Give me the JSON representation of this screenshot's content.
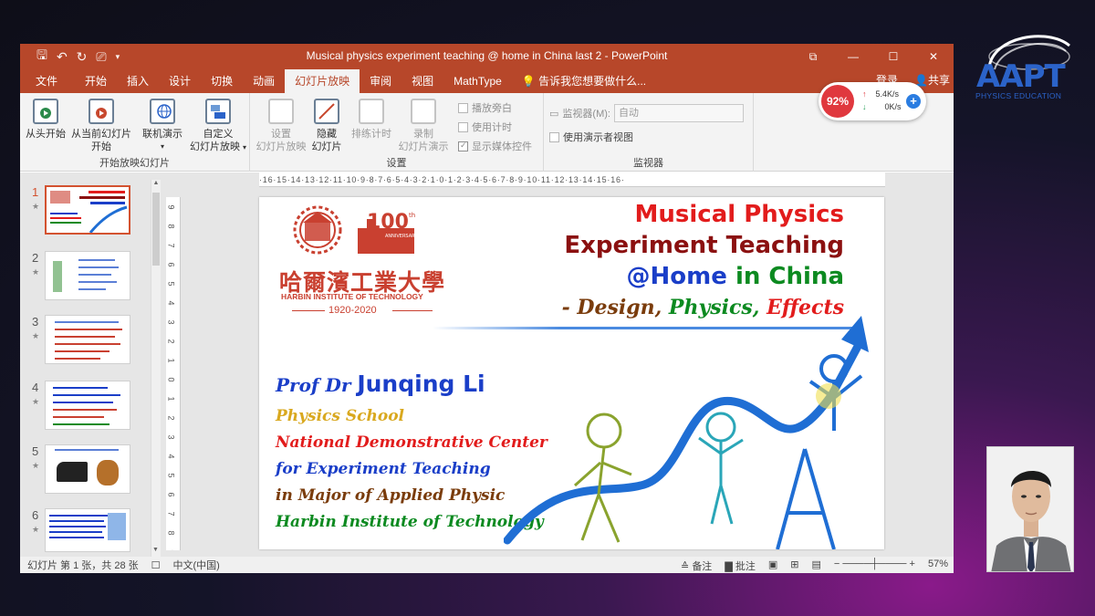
{
  "window": {
    "title": "Musical physics experiment teaching @ home in China last 2  -  PowerPoint"
  },
  "tabs": [
    {
      "label": "文件",
      "active": false
    },
    {
      "label": "开始",
      "active": false
    },
    {
      "label": "插入",
      "active": false
    },
    {
      "label": "设计",
      "active": false
    },
    {
      "label": "切换",
      "active": false
    },
    {
      "label": "动画",
      "active": false
    },
    {
      "label": "幻灯片放映",
      "active": true
    },
    {
      "label": "审阅",
      "active": false
    },
    {
      "label": "视图",
      "active": false
    },
    {
      "label": "MathType",
      "active": false
    }
  ],
  "tell_me": "告诉我您想要做什么...",
  "signin": "登录",
  "share": "共享",
  "ribbon": {
    "start_group": {
      "label": "开始放映幻灯片",
      "from_beginning": "从头开始",
      "from_current_1": "从当前幻灯片",
      "from_current_2": "开始",
      "online_present": "联机演示",
      "custom_1": "自定义",
      "custom_2": "幻灯片放映"
    },
    "setup_group": {
      "label": "设置",
      "setup_1": "设置",
      "setup_2": "幻灯片放映",
      "hide_1": "隐藏",
      "hide_2": "幻灯片",
      "rehearse": "排练计时",
      "record_1": "录制",
      "record_2": "幻灯片演示",
      "play_narration": "播放旁白",
      "use_timings": "使用计时",
      "show_media": "显示媒体控件"
    },
    "monitor_group": {
      "label": "监视器",
      "monitor_label": "监视器(M):",
      "monitor_value": "自动",
      "presenter_view": "使用演示者视图"
    }
  },
  "thumbnails": [
    {
      "num": "1",
      "selected": true
    },
    {
      "num": "2",
      "selected": false
    },
    {
      "num": "3",
      "selected": false
    },
    {
      "num": "4",
      "selected": false
    },
    {
      "num": "5",
      "selected": false
    },
    {
      "num": "6",
      "selected": false
    }
  ],
  "ruler": {
    "horizontal": "·16·15·14·13·12·11·10·9·8·7·6·5·4·3·2·1·0·1·2·3·4·5·6·7·8·9·10·11·12·13·14·15·16·",
    "vertical": [
      "9",
      "8",
      "7",
      "6",
      "5",
      "4",
      "3",
      "2",
      "1",
      "0",
      "1",
      "2",
      "3",
      "4",
      "5",
      "6",
      "7",
      "8",
      "9"
    ]
  },
  "slide": {
    "title_line1": "Musical Physics",
    "title_line2": "Experiment Teaching",
    "title_line3_a": "@Home",
    "title_line3_b": " in China",
    "subtitle_a": "- Design,",
    "subtitle_b": "  Physics,",
    "subtitle_c": " Effects",
    "logo_cn": "哈爾濱工業大學",
    "logo_en": "HARBIN INSTITUTE OF TECHNOLOGY",
    "logo_years": "1920-2020",
    "anniv_num": "100",
    "anniv_th": "th",
    "anniv_word": "ANNIVERSARY",
    "author_prefix": "Prof Dr ",
    "author_name": "Junqing Li",
    "affil1": "Physics School",
    "affil2": "National Demonstrative Center",
    "affil3": "for Experiment Teaching",
    "affil4": "in Major of Applied Physic",
    "affil5": "Harbin Institute of Technology",
    "colors": {
      "red": "#e21c1c",
      "dark_red": "#8b1010",
      "blue": "#1a3ec8",
      "green": "#0c8a20",
      "gold": "#d9a81e",
      "brown": "#7a3c0c",
      "arrow_blue": "#1f6ed4"
    }
  },
  "status": {
    "slide_info": "幻灯片 第 1 张，共 28 张",
    "language": "中文(中国)",
    "notes": "备注",
    "comments": "批注",
    "zoom": "57%"
  },
  "overlay": {
    "aapt": "AAPT",
    "aapt_sub": "PHYSICS EDUCATION",
    "speed_percent": "92%",
    "upload": "5.4K/s",
    "download": "0K/s"
  }
}
